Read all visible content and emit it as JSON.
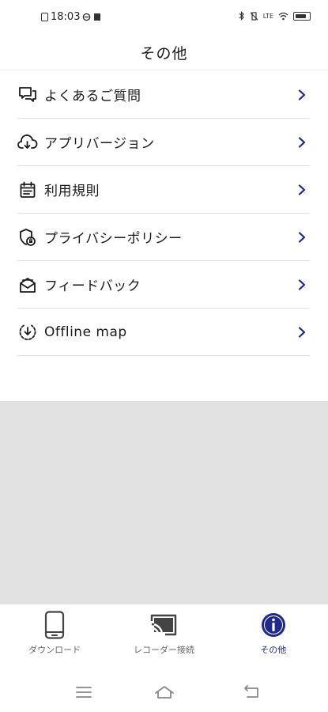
{
  "status_bar": {
    "time": "18:03",
    "right_text": "LTE"
  },
  "header": {
    "title": "その他"
  },
  "menu": {
    "items": [
      {
        "label": "よくあるご質問",
        "icon": "faq-chat-icon"
      },
      {
        "label": "アプリバージョン",
        "icon": "cloud-download-icon"
      },
      {
        "label": "利用規則",
        "icon": "calendar-terms-icon"
      },
      {
        "label": "プライバシーポリシー",
        "icon": "shield-lock-icon"
      },
      {
        "label": "フィードバック",
        "icon": "feedback-mail-icon"
      },
      {
        "label": "Offline map",
        "icon": "offline-download-icon"
      }
    ]
  },
  "tabs": [
    {
      "label": "ダウンロード",
      "icon": "phone-icon",
      "active": false
    },
    {
      "label": "レコーダー接続",
      "icon": "cast-icon",
      "active": false
    },
    {
      "label": "その他",
      "icon": "info-icon",
      "active": true
    }
  ],
  "colors": {
    "accent": "#1f2a8a",
    "chevron": "#1f2a8a",
    "gray_area": "#e2e2e2",
    "divider": "#e3e3e3"
  }
}
